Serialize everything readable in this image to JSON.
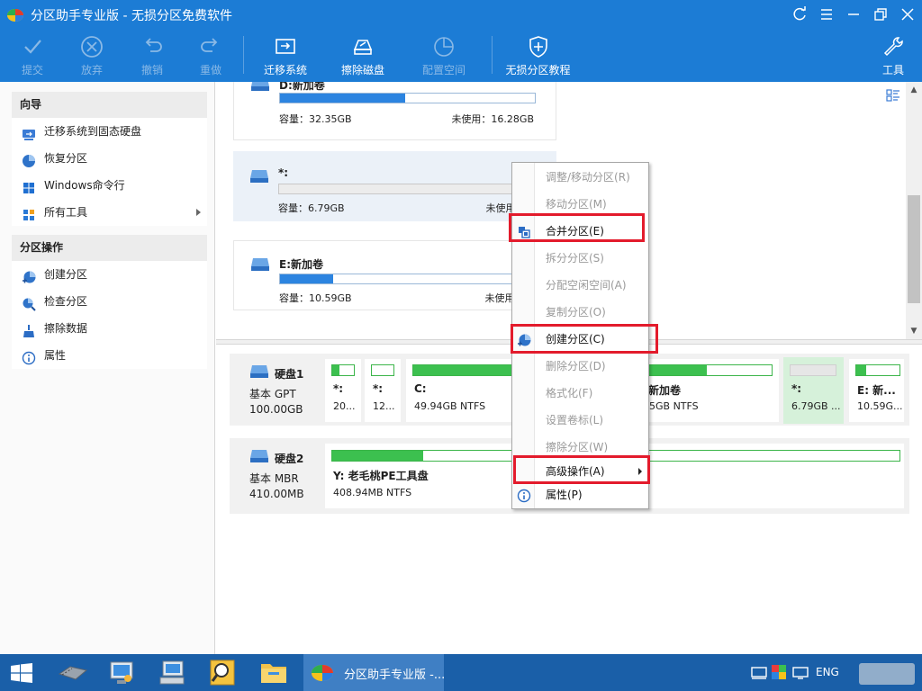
{
  "window": {
    "title": "分区助手专业版 - 无损分区免费软件",
    "icons": [
      "app-logo-icon",
      "refresh-icon",
      "menu-icon",
      "minimize-icon",
      "restore-icon",
      "close-icon"
    ]
  },
  "toolbar": {
    "commit": "提交",
    "discard": "放弃",
    "undo": "撤销",
    "redo": "重做",
    "migrate_os": "迁移系统",
    "wipe_disk": "擦除磁盘",
    "allocate_space": "配置空间",
    "tutorial": "无损分区教程",
    "tools": "工具"
  },
  "sidebar": {
    "wizard_title": "向导",
    "wizard_items": [
      {
        "label": "迁移系统到固态硬盘",
        "icon": "migrate-ssd-icon"
      },
      {
        "label": "恢复分区",
        "icon": "recover-partition-icon"
      },
      {
        "label": "Windows命令行",
        "icon": "windows-icon"
      },
      {
        "label": "所有工具",
        "icon": "tools-grid-icon"
      }
    ],
    "ops_title": "分区操作",
    "ops_items": [
      {
        "label": "创建分区",
        "icon": "create-partition-icon"
      },
      {
        "label": "检查分区",
        "icon": "check-partition-icon"
      },
      {
        "label": "擦除数据",
        "icon": "wipe-data-icon"
      },
      {
        "label": "属性",
        "icon": "info-icon"
      }
    ]
  },
  "partitions": [
    {
      "name": "D:新加卷",
      "capacity": "容量：32.35GB",
      "unused": "未使用：16.28GB",
      "used_fraction": 0.49
    },
    {
      "name": "*:",
      "capacity": "容量：6.79GB",
      "unused": "未使用：6.",
      "used_fraction": 0.0
    },
    {
      "name": "E:新加卷",
      "capacity": "容量：10.59GB",
      "unused": "未使用：8.",
      "used_fraction": 0.21
    }
  ],
  "disks": [
    {
      "name": "硬盘1",
      "type": "基本 GPT",
      "size": "100.00GB",
      "blocks": [
        {
          "name": "*:",
          "size": "20...",
          "used_fraction": 0.35
        },
        {
          "name": "*:",
          "size": "12...",
          "used_fraction": 0.0
        },
        {
          "name": "C:",
          "size": "49.94GB NTFS",
          "used_fraction": 0.72
        },
        {
          "name": "新加卷",
          "size": "35GB NTFS",
          "used_fraction": 0.48
        },
        {
          "name": "*:",
          "size": "6.79GB ...",
          "used_fraction": 0.0,
          "selected": true
        },
        {
          "name": "E: 新...",
          "size": "10.59G...",
          "used_fraction": 0.22
        }
      ]
    },
    {
      "name": "硬盘2",
      "type": "基本 MBR",
      "size": "410.00MB",
      "blocks": [
        {
          "name": "Y: 老毛桃PE工具盘",
          "size": "408.94MB NTFS",
          "used_fraction": 0.16
        }
      ]
    }
  ],
  "context_menu": {
    "items": [
      {
        "label": "调整/移动分区(R)",
        "enabled": false
      },
      {
        "label": "移动分区(M)",
        "enabled": false
      },
      {
        "label": "合并分区(E)",
        "enabled": true,
        "icon": "merge-icon",
        "highlighted": true
      },
      {
        "label": "拆分分区(S)",
        "enabled": false
      },
      {
        "label": "分配空闲空间(A)",
        "enabled": false
      },
      {
        "label": "复制分区(O)",
        "enabled": false
      },
      {
        "label": "创建分区(C)",
        "enabled": true,
        "icon": "create-partition-icon",
        "highlighted": true
      },
      {
        "label": "删除分区(D)",
        "enabled": false
      },
      {
        "label": "格式化(F)",
        "enabled": false
      },
      {
        "label": "设置卷标(L)",
        "enabled": false
      },
      {
        "label": "擦除分区(W)",
        "enabled": false
      },
      {
        "label": "高级操作(A)",
        "enabled": true,
        "submenu": true,
        "highlighted": true
      },
      {
        "label": "属性(P)",
        "enabled": true,
        "icon": "info-icon"
      }
    ]
  },
  "taskbar": {
    "active_app_label": "分区助手专业版 -...",
    "language": "ENG",
    "apps": [
      "start-icon",
      "hardware-icon",
      "network-computer-icon",
      "keyboard-computer-icon",
      "search-tool-icon",
      "folder-icon",
      "partition-assistant-icon"
    ]
  },
  "colors": {
    "titlebar": "#1c7cd5",
    "taskbar": "#1a5fa8",
    "partition_bar": "#2c84e0",
    "disk_bar": "#3cc04f",
    "highlight_box": "#e31b2c",
    "selected_block": "#d6f1da"
  }
}
